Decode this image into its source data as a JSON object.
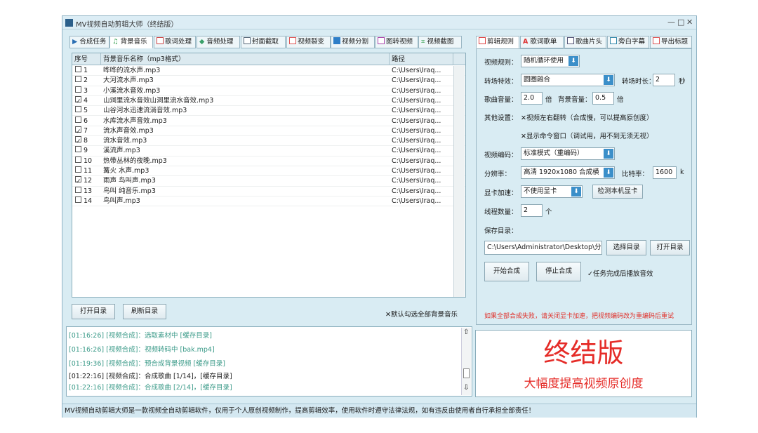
{
  "window": {
    "title": "MV视频自动剪辑大师（终结版）",
    "controls": [
      "—",
      "□",
      "✕"
    ]
  },
  "left_tabs": [
    {
      "label": "合成任务",
      "active": false
    },
    {
      "label": "背景音乐",
      "active": true
    },
    {
      "label": "歌词处理",
      "active": false
    },
    {
      "label": "音频处理",
      "active": false
    },
    {
      "label": "封面截取",
      "active": false
    },
    {
      "label": "视频裂变",
      "active": false
    },
    {
      "label": "视频分割",
      "active": false
    },
    {
      "label": "图转视频",
      "active": false
    },
    {
      "label": "视频截图",
      "active": false
    }
  ],
  "table": {
    "headers": {
      "index": "序号",
      "name": "背景音乐名称（mp3格式）",
      "path": "路径"
    },
    "rows": [
      {
        "checked": false,
        "index": "1",
        "name": "哗哗的流水声.mp3",
        "path": "C:\\Users\\Iraq..."
      },
      {
        "checked": false,
        "index": "2",
        "name": "大河流水声.mp3",
        "path": "C:\\Users\\Iraq..."
      },
      {
        "checked": false,
        "index": "3",
        "name": "小溪流水音效.mp3",
        "path": "C:\\Users\\Iraq..."
      },
      {
        "checked": true,
        "index": "4",
        "name": "山涧里流水音效山洞里流水音效.mp3",
        "path": "C:\\Users\\Iraq..."
      },
      {
        "checked": false,
        "index": "5",
        "name": "山谷河水迅速流淌音效.mp3",
        "path": "C:\\Users\\Iraq..."
      },
      {
        "checked": false,
        "index": "6",
        "name": "水库流水声音效.mp3",
        "path": "C:\\Users\\Iraq..."
      },
      {
        "checked": true,
        "index": "7",
        "name": "流水声音效.mp3",
        "path": "C:\\Users\\Iraq..."
      },
      {
        "checked": true,
        "index": "8",
        "name": "流水音效.mp3",
        "path": "C:\\Users\\Iraq..."
      },
      {
        "checked": false,
        "index": "9",
        "name": "溪流声.mp3",
        "path": "C:\\Users\\Iraq..."
      },
      {
        "checked": false,
        "index": "10",
        "name": "热带丛林的夜晚.mp3",
        "path": "C:\\Users\\Iraq..."
      },
      {
        "checked": false,
        "index": "11",
        "name": "篝火 水声.mp3",
        "path": "C:\\Users\\Iraq..."
      },
      {
        "checked": true,
        "index": "12",
        "name": "雨声 鸟叫声.mp3",
        "path": "C:\\Users\\Iraq..."
      },
      {
        "checked": false,
        "index": "13",
        "name": "鸟叫 纯音乐.mp3",
        "path": "C:\\Users\\Iraq..."
      },
      {
        "checked": false,
        "index": "14",
        "name": "鸟叫声.mp3",
        "path": "C:\\Users\\Iraq..."
      }
    ]
  },
  "left_buttons": {
    "open_dir": "打开目录",
    "refresh_dir": "刷新目录"
  },
  "default_all_bgm": "✕默认勾选全部背景音乐",
  "log": [
    {
      "text": "[01:16:26] [视频合成]：选取素材中 [缓存目录]",
      "black": false
    },
    {
      "text": "[01:16:26] [视频合成]：视频转码中 [bak.mp4]",
      "black": false
    },
    {
      "text": "[01:19:36] [视频合成]：预合成背景视频 [缓存目录]",
      "black": false
    },
    {
      "text": "[01:22:16] [视频合成]：合成歌曲 [1/14]，[缓存目录]",
      "black": true
    },
    {
      "text": "[01:22:16] [视频合成]：合成歌曲 [2/14]，[缓存目录]",
      "black": false
    }
  ],
  "right_tabs": [
    {
      "label": "剪辑规则",
      "active": true
    },
    {
      "label": "歌词歌单",
      "active": false
    },
    {
      "label": "歌曲片头",
      "active": false
    },
    {
      "label": "旁白字幕",
      "active": false
    },
    {
      "label": "导出标题",
      "active": false
    }
  ],
  "settings": {
    "rule_label": "视频规则：",
    "rule_value": "随机循环使用",
    "transition_label": "转场特效：",
    "transition_value": "圆圈融合",
    "transition_duration_label": "转场时长：",
    "transition_duration_value": "2",
    "seconds_unit": "秒",
    "song_volume_label": "歌曲音量：",
    "song_volume_value": "2.0",
    "times_unit": "倍",
    "bg_volume_label": "背景音量：",
    "bg_volume_value": "0.5",
    "times_unit2": "倍",
    "other_label": "其他设置：",
    "option_flip": "✕视频左右翻转（合成慢，可以提高原创度）",
    "option_console": "✕显示命令窗口（调试用，用不到无须无视）",
    "codec_label": "视频编码：",
    "codec_value": "标准模式（重编码）",
    "resolution_label": "分辨率：",
    "resolution_value": "高清 1920x1080 合成横",
    "bitrate_label": "比特率：",
    "bitrate_value": "1600",
    "bitrate_unit": "k",
    "gpu_label": "显卡加速：",
    "gpu_value": "不使用显卡",
    "gpu_detect": "检测本机显卡",
    "threads_label": "线程数量：",
    "threads_value": "2",
    "threads_unit": "个",
    "save_label": "保存目录：",
    "save_value": "C:\\Users\\Administrator\\Desktop\\分",
    "choose_dir": "选择目录",
    "open_dir": "打开目录",
    "start": "开始合成",
    "stop": "停止合成",
    "finish_sound": "✓任务完成后播放音效",
    "warning": "如果全部合成失败，请关闭显卡加速，把视频编码改为重编码后重试"
  },
  "brand": {
    "title": "终结版",
    "subtitle": "大幅度提高视频原创度"
  },
  "status": "MV视频自动剪辑大师是一款视频全自动剪辑软件，仅用于个人原创视频制作，提高剪辑效率，使用软件时遵守法律法规，如有违反由使用者自行承担全部责任！",
  "colors": {
    "accent": "#3b8fc9",
    "warning": "#e0302a",
    "brand_red": "#e52c28",
    "log_teal": "#3a9a88"
  }
}
